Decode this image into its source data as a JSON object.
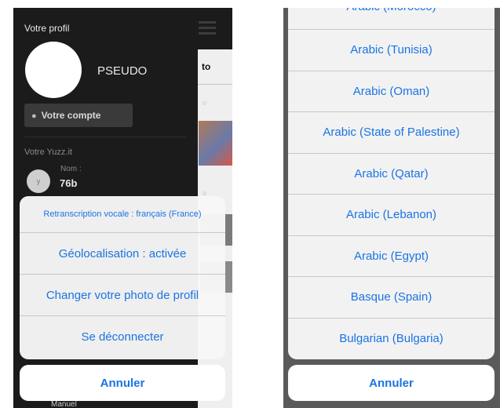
{
  "left": {
    "profile_label": "Votre profil",
    "pseudo": "PSEUDO",
    "account_button": "Votre compte",
    "yuzz_label": "Votre Yuzz.it",
    "name_label": "Nom :",
    "name_value": "76b",
    "feed_tab": "to",
    "action_sheet": {
      "title": "Retranscription vocale : français (France)",
      "options": [
        "Géolocalisation : activée",
        "Changer votre photo de profil",
        "Se déconnecter"
      ]
    },
    "cancel": "Annuler",
    "under_text": "Manuel"
  },
  "right": {
    "options": [
      "Arabic (Morocco)",
      "Arabic (Tunisia)",
      "Arabic (Oman)",
      "Arabic (State of Palestine)",
      "Arabic (Qatar)",
      "Arabic (Lebanon)",
      "Arabic (Egypt)",
      "Basque (Spain)",
      "Bulgarian (Bulgaria)"
    ],
    "cancel": "Annuler"
  },
  "colors": {
    "accent": "#1a74e4",
    "app_background": "#1b1b1b"
  }
}
